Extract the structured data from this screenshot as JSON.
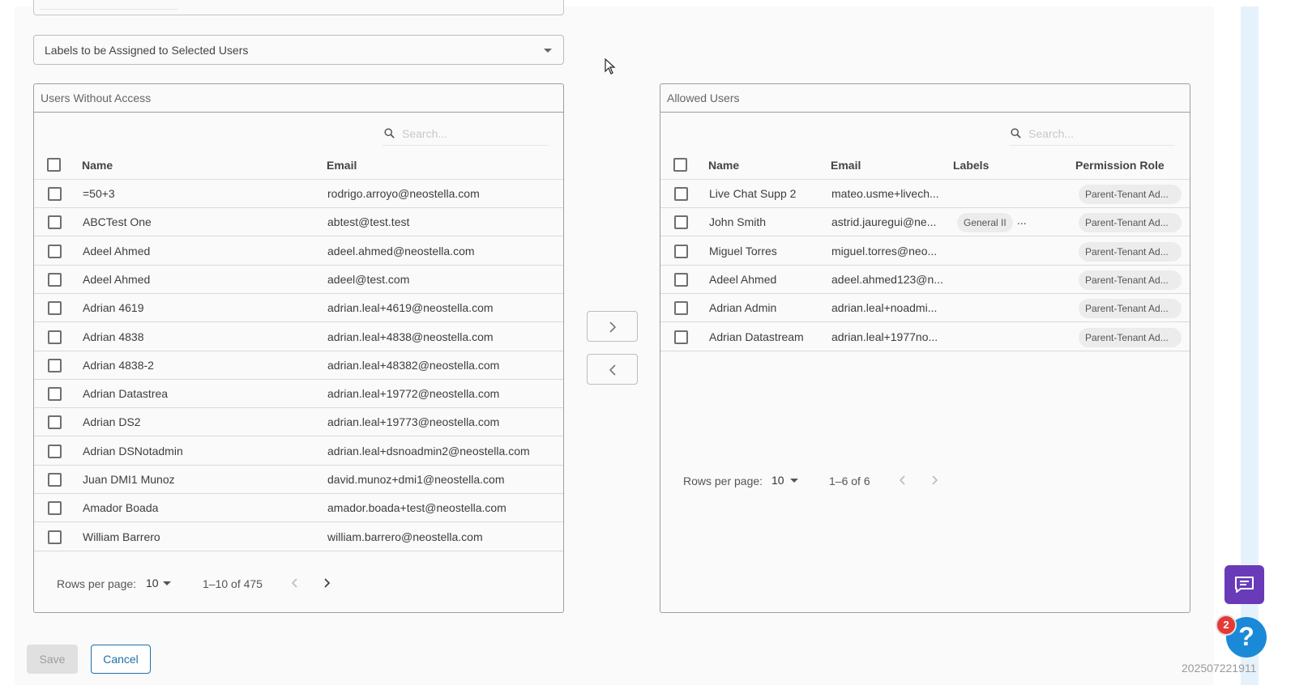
{
  "labels_select": {
    "placeholder": "Labels to be Assigned to Selected Users"
  },
  "left_panel": {
    "title": "Users Without Access",
    "search_placeholder": "Search...",
    "columns": [
      "Name",
      "Email"
    ],
    "rows": [
      {
        "name": "=50+3",
        "email": "rodrigo.arroyo@neostella.com"
      },
      {
        "name": "ABCTest One",
        "email": "abtest@test.test"
      },
      {
        "name": "Adeel Ahmed",
        "email": "adeel.ahmed@neostella.com"
      },
      {
        "name": "Adeel Ahmed",
        "email": "adeel@test.com"
      },
      {
        "name": "Adrian 4619",
        "email": "adrian.leal+4619@neostella.com"
      },
      {
        "name": "Adrian 4838",
        "email": "adrian.leal+4838@neostella.com"
      },
      {
        "name": "Adrian 4838-2",
        "email": "adrian.leal+48382@neostella.com"
      },
      {
        "name": "Adrian Datastrea",
        "email": "adrian.leal+19772@neostella.com"
      },
      {
        "name": "Adrian DS2",
        "email": "adrian.leal+19773@neostella.com"
      },
      {
        "name": "Adrian DSNotadmin",
        "email": "adrian.leal+dsnoadmin2@neostella.com"
      },
      {
        "name": "Juan DMI1 Munoz",
        "email": "david.munoz+dmi1@neostella.com"
      },
      {
        "name": "Amador Boada",
        "email": "amador.boada+test@neostella.com"
      },
      {
        "name": "William Barrero",
        "email": "william.barrero@neostella.com"
      }
    ],
    "rows_per_page_label": "Rows per page:",
    "rows_per_page": "10",
    "pagination": "1–10 of 475"
  },
  "right_panel": {
    "title": "Allowed Users",
    "search_placeholder": "Search...",
    "columns": [
      "Name",
      "Email",
      "Labels",
      "Permission Role"
    ],
    "rows": [
      {
        "name": "Live Chat Supp 2",
        "email": "mateo.usme+livech...",
        "label": "",
        "more": "",
        "role": "Parent-Tenant Ad..."
      },
      {
        "name": "John Smith",
        "email": "astrid.jauregui@ne...",
        "label": "General II",
        "more": "...",
        "role": "Parent-Tenant Ad..."
      },
      {
        "name": "Miguel Torres",
        "email": "miguel.torres@neo...",
        "label": "",
        "more": "",
        "role": "Parent-Tenant Ad..."
      },
      {
        "name": "Adeel Ahmed",
        "email": "adeel.ahmed123@n...",
        "label": "",
        "more": "",
        "role": "Parent-Tenant Ad..."
      },
      {
        "name": "Adrian Admin",
        "email": "adrian.leal+noadmi...",
        "label": "",
        "more": "",
        "role": "Parent-Tenant Ad..."
      },
      {
        "name": "Adrian Datastream",
        "email": "adrian.leal+1977no...",
        "label": "",
        "more": "",
        "role": "Parent-Tenant Ad..."
      }
    ],
    "rows_per_page_label": "Rows per page:",
    "rows_per_page": "10",
    "pagination": "1–6 of 6"
  },
  "actions": {
    "save_label": "Save",
    "cancel_label": "Cancel"
  },
  "help": {
    "badge_count": "2",
    "glyph": "?"
  },
  "version": "202507221911",
  "icons": [
    "search-icon",
    "chevron-right-icon",
    "chevron-left-icon",
    "chat-icon",
    "help-icon",
    "caret-down-icon"
  ],
  "colors": {
    "accent": "#1f6fa8",
    "chat": "#6a3bb8",
    "help": "#1a8ad8",
    "badge": "#e53935"
  }
}
